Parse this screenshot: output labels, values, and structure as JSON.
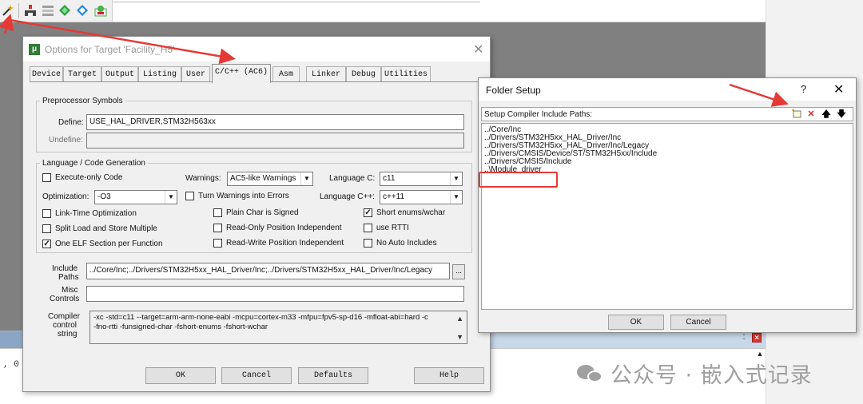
{
  "ide": {
    "output_fragment": ", 0",
    "pin_glyph": "⍘",
    "close_glyph": "×"
  },
  "watermark": {
    "text": "公众号 · 嵌入式记录"
  },
  "options_dialog": {
    "title": "Options for Target 'Facility_H5'",
    "close_glyph": "✕",
    "tabs": [
      "Device",
      "Target",
      "Output",
      "Listing",
      "User",
      "C/C++ (AC6)",
      "Asm",
      "Linker",
      "Debug",
      "Utilities"
    ],
    "active_tab": "C/C++ (AC6)",
    "preprocessor": {
      "legend": "Preprocessor Symbols",
      "define_label": "Define:",
      "define_value": "USE_HAL_DRIVER,STM32H563xx",
      "undefine_label": "Undefine:",
      "undefine_value": ""
    },
    "codegen": {
      "legend": "Language / Code Generation",
      "execute_only": {
        "label": "Execute-only Code",
        "checked": false
      },
      "warnings_label": "Warnings:",
      "warnings_value": "AC5-like Warnings",
      "language_c_label": "Language C:",
      "language_c_value": "c11",
      "optimization_label": "Optimization:",
      "optimization_value": "-O3",
      "turn_warnings": {
        "label": "Turn Warnings into Errors",
        "checked": false
      },
      "language_cpp_label": "Language C++:",
      "language_cpp_value": "c++11",
      "lto": {
        "label": "Link-Time Optimization",
        "checked": false
      },
      "plain_char": {
        "label": "Plain Char is Signed",
        "checked": false
      },
      "short_enums": {
        "label": "Short enums/wchar",
        "checked": true
      },
      "split_load": {
        "label": "Split Load and Store Multiple",
        "checked": false
      },
      "ro_pi": {
        "label": "Read-Only Position Independent",
        "checked": false
      },
      "rtti": {
        "label": "use RTTI",
        "checked": false
      },
      "one_elf": {
        "label": "One ELF Section per Function",
        "checked": true
      },
      "rw_pi": {
        "label": "Read-Write Position Independent",
        "checked": false
      },
      "no_auto_includes": {
        "label": "No Auto Includes",
        "checked": false
      }
    },
    "include_label_1": "Include",
    "include_label_2": "Paths",
    "include_value": "../Core/Inc;../Drivers/STM32H5xx_HAL_Driver/Inc;../Drivers/STM32H5xx_HAL_Driver/Inc/Legacy",
    "ellipsis": "...",
    "misc_label_1": "Misc",
    "misc_label_2": "Controls",
    "misc_value": "",
    "compiler_label_1": "Compiler",
    "compiler_label_2": "control",
    "compiler_label_3": "string",
    "compiler_line_1": "-xc -std=c11 --target=arm-arm-none-eabi -mcpu=cortex-m33 -mfpu=fpv5-sp-d16 -mfloat-abi=hard -c",
    "compiler_line_2": "-fno-rtti -funsigned-char -fshort-enums -fshort-wchar",
    "buttons": {
      "ok": "OK",
      "cancel": "Cancel",
      "defaults": "Defaults",
      "help": "Help"
    }
  },
  "folder_setup": {
    "title": "Folder Setup",
    "help_glyph": "?",
    "close_glyph": "✕",
    "header_label": "Setup Compiler Include Paths:",
    "toolbar_icons": [
      "new-folder-icon",
      "delete-icon",
      "move-up-icon",
      "move-down-icon"
    ],
    "paths": [
      "../Core/Inc",
      "../Drivers/STM32H5xx_HAL_Driver/Inc",
      "../Drivers/STM32H5xx_HAL_Driver/Inc/Legacy",
      "../Drivers/CMSIS/Device/ST/STM32H5xx/Include",
      "../Drivers/CMSIS/Include",
      "..\\Module_driver"
    ],
    "ok": "OK",
    "cancel": "Cancel"
  },
  "colors": {
    "annotation_red": "#e53935",
    "watermark_gray": "#a0a0a0",
    "editor_gray": "#808080"
  }
}
